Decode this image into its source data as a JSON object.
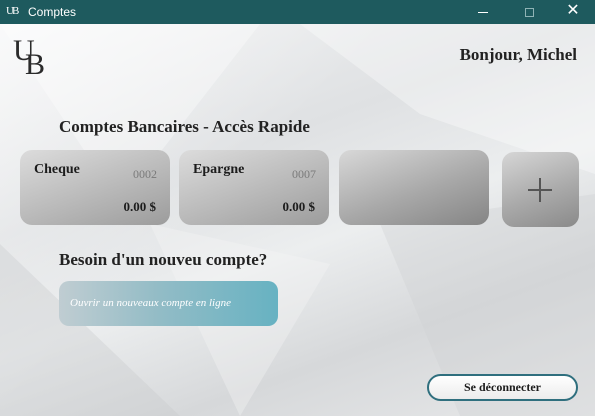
{
  "window": {
    "title": "Comptes",
    "icon": "ub-logo-icon",
    "buttons": [
      "minimize-icon",
      "maximize-icon",
      "close-icon"
    ],
    "close_glyph": "✕"
  },
  "brand": {
    "logo_u": "U",
    "logo_b": "B"
  },
  "header": {
    "greeting": "Bonjour, Michel"
  },
  "quick_access": {
    "title": "Comptes Bancaires - Accès Rapide",
    "accounts": [
      {
        "name": "Cheque",
        "number": "0002",
        "balance": "0.00 $"
      },
      {
        "name": "Epargne",
        "number": "0007",
        "balance": "0.00 $"
      },
      {
        "name": "",
        "number": "",
        "balance": ""
      }
    ],
    "add_icon": "plus-icon"
  },
  "new_account": {
    "title": "Besoin d'un nouveu compte?",
    "button_label": "Ouvrir un nouveaux compte en ligne"
  },
  "footer": {
    "logout_label": "Se déconnecter"
  },
  "colors": {
    "titlebar": "#1e5a5e",
    "accent": "#67b2c2",
    "logout_border": "#2f6f7e"
  }
}
